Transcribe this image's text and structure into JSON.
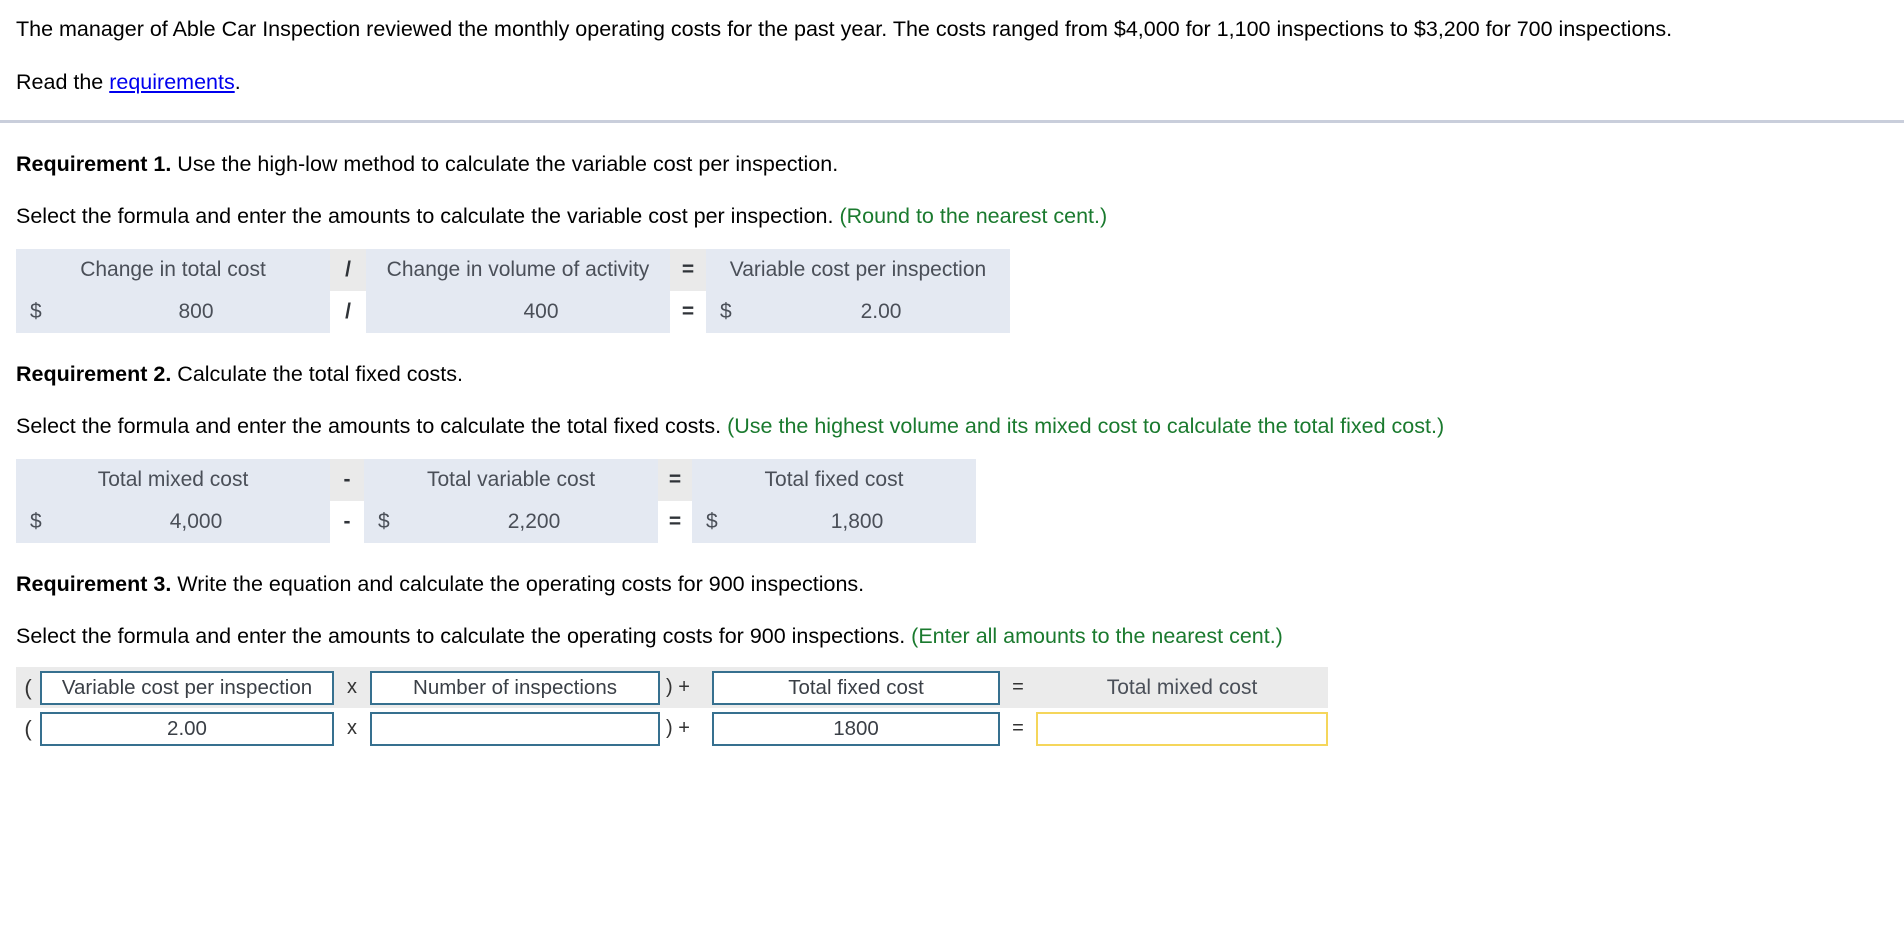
{
  "intro": {
    "paragraph": "The manager of Able Car Inspection reviewed the monthly operating costs for the past year. The costs ranged from $4,000 for 1,100 inspections to $3,200 for 700 inspections.",
    "read_prefix": "Read the ",
    "link_text": "requirements",
    "read_suffix": "."
  },
  "requirement1": {
    "label": "Requirement 1.",
    "heading": " Use the high-low method to calculate the variable cost per inspection.",
    "instruction": "Select the formula and enter the amounts to calculate the variable cost per inspection. ",
    "hint": "(Round to the nearest cent.)",
    "table": {
      "headers": [
        "Change in total cost",
        "Change in volume of activity",
        "Variable cost per inspection"
      ],
      "operators": [
        "/",
        "="
      ],
      "currency_left": "$",
      "value_left": "800",
      "value_mid": "400",
      "currency_right": "$",
      "value_right": "2.00"
    }
  },
  "requirement2": {
    "label": "Requirement 2.",
    "heading": " Calculate the total fixed costs.",
    "instruction": "Select the formula and enter the amounts to calculate the total fixed costs. ",
    "hint": "(Use the highest volume and its mixed cost to calculate the total fixed cost.)",
    "table": {
      "headers": [
        "Total mixed cost",
        "Total variable cost",
        "Total fixed cost"
      ],
      "operators": [
        "-",
        "="
      ],
      "currency_left": "$",
      "value_left": "4,000",
      "currency_mid": "$",
      "value_mid": "2,200",
      "currency_right": "$",
      "value_right": "1,800"
    }
  },
  "requirement3": {
    "label": "Requirement 3.",
    "heading": " Write the equation and calculate the operating costs for 900 inspections.",
    "instruction": "Select the formula and enter the amounts to calculate the operating costs for 900 inspections. ",
    "hint": "(Enter all amounts to the nearest cent.)",
    "equation": {
      "open_paren": "(",
      "multiply": "x",
      "close_plus": ") +",
      "equals": "=",
      "header_fields": {
        "variable_cost": "Variable cost per inspection",
        "number_of_inspections": "Number of inspections",
        "total_fixed_cost": "Total fixed cost",
        "total_mixed_cost": "Total mixed cost"
      },
      "value_fields": {
        "variable_cost": "2.00",
        "number_of_inspections": "",
        "total_fixed_cost": "1800",
        "total_mixed_cost": ""
      }
    }
  },
  "colors": {
    "table_blue": "#e4e9f2",
    "table_gray": "#eaeaea",
    "hint_green": "#1a7a2e",
    "link_blue": "#0000ee",
    "field_border": "#36708f",
    "active_border": "#f5d65b",
    "divider": "#c9cedb"
  }
}
